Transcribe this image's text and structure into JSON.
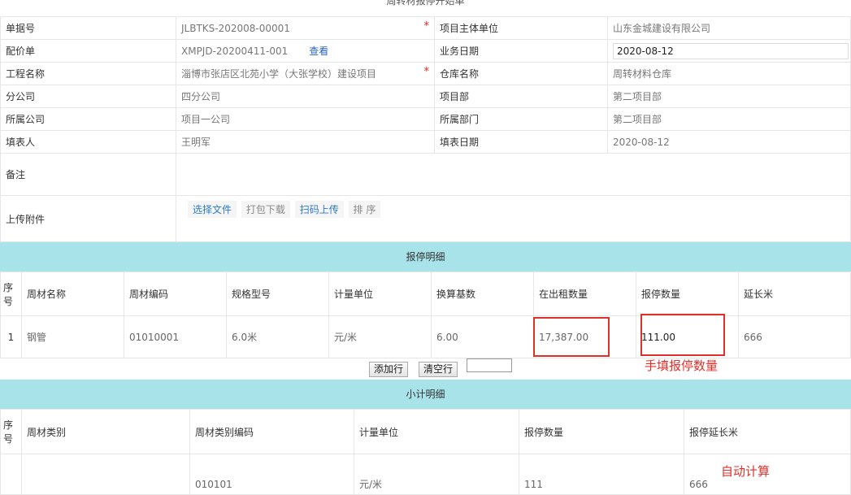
{
  "title": "周转材报停开始单",
  "form": {
    "row1": {
      "l1": "单据号",
      "v1": "JLBTKS-202008-00001",
      "l2": "项目主体单位",
      "v2": "山东金城建设有限公司"
    },
    "row2": {
      "l1": "配价单",
      "v1": "XMPJD-20200411-001",
      "link": "查看",
      "l2": "业务日期",
      "v2": "2020-08-12"
    },
    "row3": {
      "l1": "工程名称",
      "v1": "淄博市张店区北苑小学（大张学校）建设项目",
      "l2": "仓库名称",
      "v2": "周转材料仓库"
    },
    "row4": {
      "l1": "分公司",
      "v1": "四分公司",
      "l2": "项目部",
      "v2": "第二项目部"
    },
    "row5": {
      "l1": "所属公司",
      "v1": "项目一公司",
      "l2": "所属部门",
      "v2": "第二项目部"
    },
    "row6": {
      "l1": "填表人",
      "v1": "王明军",
      "l2": "填表日期",
      "v2": "2020-08-12"
    },
    "remark_label": "备注",
    "upload_label": "上传附件",
    "upload_btns": {
      "select": "选择文件",
      "pack": "打包下载",
      "scan": "扫码上传",
      "sort": "排 序"
    },
    "required_mark": "*"
  },
  "detail": {
    "title": "报停明细",
    "headers": [
      "序号",
      "周材名称",
      "周材编码",
      "规格型号",
      "计量单位",
      "换算基数",
      "在出租数量",
      "报停数量",
      "延长米"
    ],
    "rows": [
      [
        "1",
        "钢管",
        "01010001",
        "6.0米",
        "元/米",
        "6.00",
        "17,387.00",
        "111.00",
        "666"
      ]
    ],
    "add_row": "添加行",
    "clear_row": "清空行",
    "annotation": "手填报停数量"
  },
  "subtotal": {
    "title": "小计明细",
    "headers": [
      "序号",
      "周材类别",
      "周材类别编码",
      "计量单位",
      "报停数量",
      "报停延长米"
    ],
    "rows": [
      [
        "",
        "",
        "010101",
        "元/米",
        "111",
        "666"
      ]
    ],
    "annotation": "自动计算"
  }
}
